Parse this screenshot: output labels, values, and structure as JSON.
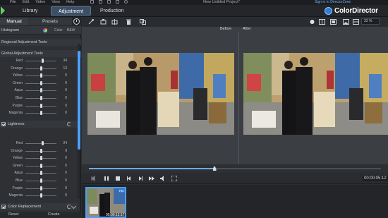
{
  "menu": {
    "items": [
      "File",
      "Edit",
      "Video",
      "View",
      "Help"
    ],
    "title": "New Untitled Project*",
    "signin": "Sign in to DirectorZone"
  },
  "header": {
    "tabs": [
      {
        "label": "Library",
        "active": false
      },
      {
        "label": "Adjustment",
        "active": true
      },
      {
        "label": "Production",
        "active": false
      }
    ],
    "brand": "ColorDirector"
  },
  "left_panel": {
    "tabs": {
      "manual": "Manual",
      "presets": "Presets"
    },
    "histogram_label": "Histogram",
    "histogram_options": {
      "color": "Color",
      "bw": "B&W"
    },
    "regional_tools": "Regional Adjustment Tools",
    "global_tools": "Global Adjustment Tools",
    "hsl_sliders": [
      {
        "name": "Red",
        "value": "34",
        "level": 0.55
      },
      {
        "name": "Orange",
        "value": "13",
        "level": 0.52
      },
      {
        "name": "Yellow",
        "value": "0",
        "level": 0.5
      },
      {
        "name": "Green",
        "value": "0",
        "level": 0.5
      },
      {
        "name": "Aqua",
        "value": "0",
        "level": 0.5
      },
      {
        "name": "Blue",
        "value": "0",
        "level": 0.5
      },
      {
        "name": "Purple",
        "value": "0",
        "level": 0.5
      },
      {
        "name": "Magenta",
        "value": "0",
        "level": 0.5
      }
    ],
    "lightness_label": "Lightness",
    "lightness_sliders": [
      {
        "name": "Red",
        "value": "24",
        "level": 0.55
      },
      {
        "name": "Orange",
        "value": "9",
        "level": 0.52
      },
      {
        "name": "Yellow",
        "value": "0",
        "level": 0.5
      },
      {
        "name": "Green",
        "value": "0",
        "level": 0.5
      },
      {
        "name": "Aqua",
        "value": "0",
        "level": 0.5
      },
      {
        "name": "Blue",
        "value": "0",
        "level": 0.5
      },
      {
        "name": "Purple",
        "value": "0",
        "level": 0.5
      },
      {
        "name": "Magenta",
        "value": "0",
        "level": 0.5
      }
    ],
    "color_replacement": "Color Replacement",
    "bottom_buttons": [
      "Reset",
      "Create"
    ]
  },
  "preview": {
    "before_label": "Before",
    "after_label": "After",
    "zoom": "33 %"
  },
  "playback": {
    "progress": 0.43,
    "timecode": "00:00:05:12"
  },
  "filmstrip": {
    "thumb_timecode": "00:00:13:17",
    "thumb_badge": "HD"
  },
  "colors": {
    "accent": "#3d4f66",
    "selection": "#4aa0ff",
    "progress": "#6fa9e8",
    "brand_green": "#6ad06a"
  }
}
